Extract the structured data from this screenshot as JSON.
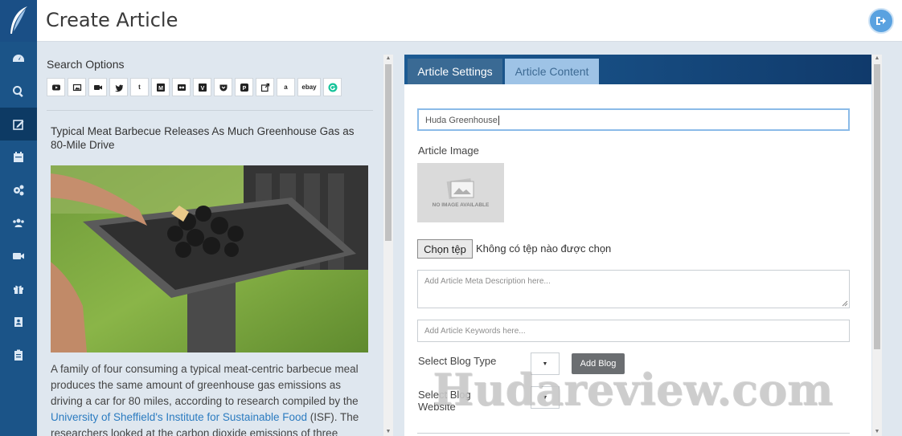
{
  "header": {
    "title": "Create Article",
    "logout_icon": "sign-out-icon"
  },
  "sidebar": {
    "items": [
      {
        "icon": "dashboard-icon",
        "active": false
      },
      {
        "icon": "search-icon",
        "active": false
      },
      {
        "icon": "edit-icon",
        "active": true
      },
      {
        "icon": "calendar-icon",
        "active": false
      },
      {
        "icon": "cogs-icon",
        "active": false
      },
      {
        "icon": "users-icon",
        "active": false
      },
      {
        "icon": "video-icon",
        "active": false
      },
      {
        "icon": "gift-icon",
        "active": false
      },
      {
        "icon": "contact-book-icon",
        "active": false
      },
      {
        "icon": "clipboard-icon",
        "active": false
      }
    ]
  },
  "search": {
    "label": "Search Options",
    "sources": [
      {
        "name": "youtube-icon"
      },
      {
        "name": "image-icon"
      },
      {
        "name": "video-camera-icon"
      },
      {
        "name": "twitter-icon"
      },
      {
        "name": "tumblr-icon",
        "glyph": "t"
      },
      {
        "name": "medium-icon",
        "glyph": "M"
      },
      {
        "name": "flickr-icon"
      },
      {
        "name": "vimeo-icon",
        "glyph": "V"
      },
      {
        "name": "pocket-icon"
      },
      {
        "name": "pinterest-icon",
        "glyph": "P"
      },
      {
        "name": "external-link-icon"
      },
      {
        "name": "amazon-icon",
        "glyph": "a"
      },
      {
        "name": "ebay-icon",
        "glyph": "ebay"
      },
      {
        "name": "grammarly-icon"
      }
    ]
  },
  "article": {
    "title": "Typical Meat Barbecue Releases As Much Greenhouse Gas as 80-Mile Drive",
    "body_1": "A family of four consuming a typical meat-centric barbecue meal produces the same amount of greenhouse gas emissions as driving a car for 80 miles, according to research compiled by the ",
    "body_link": "University of Sheffield's Institute for Sustainable Food",
    "body_2": " (ISF). The researchers looked at the carbon dioxide emissions of three"
  },
  "tabs": [
    {
      "label": "Article Settings",
      "active": true
    },
    {
      "label": "Article Content",
      "active": false
    }
  ],
  "form": {
    "title_value": "Huda Greenhouse",
    "image_label": "Article Image",
    "no_image_text": "NO IMAGE AVAILABLE",
    "file_button": "Chọn tệp",
    "file_status": "Không có tệp nào được chọn",
    "meta_placeholder": "Add Article Meta Description here...",
    "keywords_placeholder": "Add Article Keywords here...",
    "blog_type_label": "Select Blog Type",
    "add_blog_button": "Add Blog",
    "blog_website_label_1": "Select Blog",
    "blog_website_label_2": "Website"
  },
  "watermark": "Hudareview.com",
  "colors": {
    "sidebar": "#1b5488",
    "accent": "#5aa2e0",
    "active_tab": "#3a6a94",
    "inactive_tab": "#9ec3e6"
  }
}
